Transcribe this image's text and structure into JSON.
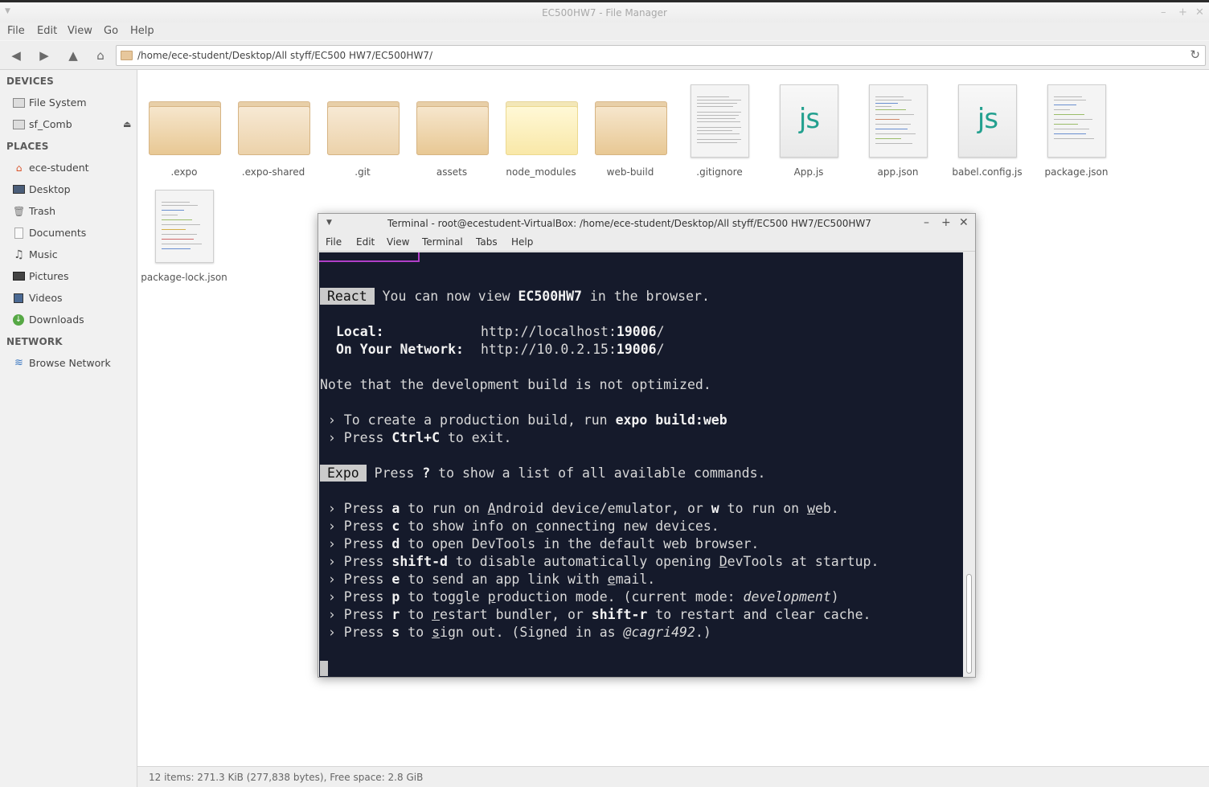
{
  "file_manager": {
    "title": "EC500HW7 - File Manager",
    "menu": [
      "File",
      "Edit",
      "View",
      "Go",
      "Help"
    ],
    "path": "/home/ece-student/Desktop/All styff/EC500 HW7/EC500HW7/",
    "sidebar": {
      "devices_heading": "DEVICES",
      "devices": [
        {
          "label": "File System",
          "icon": "drive-icon"
        },
        {
          "label": "sf_Comb",
          "icon": "drive-icon"
        }
      ],
      "places_heading": "PLACES",
      "places": [
        {
          "label": "ece-student",
          "icon": "home-icon"
        },
        {
          "label": "Desktop",
          "icon": "desktop-icon"
        },
        {
          "label": "Trash",
          "icon": "trash-icon"
        },
        {
          "label": "Documents",
          "icon": "documents-icon"
        },
        {
          "label": "Music",
          "icon": "music-icon"
        },
        {
          "label": "Pictures",
          "icon": "pictures-icon"
        },
        {
          "label": "Videos",
          "icon": "videos-icon"
        },
        {
          "label": "Downloads",
          "icon": "downloads-icon"
        }
      ],
      "network_heading": "NETWORK",
      "network": [
        {
          "label": "Browse Network",
          "icon": "network-icon"
        }
      ]
    },
    "items": [
      {
        "name": ".expo",
        "kind": "folder"
      },
      {
        "name": ".expo-shared",
        "kind": "folder"
      },
      {
        "name": ".git",
        "kind": "folder"
      },
      {
        "name": "assets",
        "kind": "folder"
      },
      {
        "name": "node_modules",
        "kind": "folder"
      },
      {
        "name": "web-build",
        "kind": "folder"
      },
      {
        "name": ".gitignore",
        "kind": "text"
      },
      {
        "name": "App.js",
        "kind": "js"
      },
      {
        "name": "app.json",
        "kind": "text"
      },
      {
        "name": "babel.config.js",
        "kind": "js"
      },
      {
        "name": "package.json",
        "kind": "text"
      },
      {
        "name": "package-lock.json",
        "kind": "text"
      }
    ],
    "js_glyph": "js",
    "status": "12 items: 271.3 KiB (277,838 bytes), Free space: 2.8 GiB"
  },
  "terminal": {
    "title": "Terminal - root@ecestudent-VirtualBox: /home/ece-student/Desktop/All styff/EC500 HW7/EC500HW7",
    "menu": [
      "File",
      "Edit",
      "View",
      "Terminal",
      "Tabs",
      "Help"
    ],
    "react_tag": "React",
    "react_line_pre": " You can now view ",
    "react_line_app": "EC500HW7",
    "react_line_post": " in the browser.",
    "local_label": "Local:",
    "local_url_pre": "http://localhost:",
    "local_port": "19006",
    "local_url_post": "/",
    "network_label": "On Your Network:",
    "network_url_pre": "http://10.0.2.15:",
    "network_port": "19006",
    "network_url_post": "/",
    "note": "Note that the development build is not optimized.",
    "build_pre": " › To create a production build, run ",
    "build_cmd": "expo build:web",
    "exit_pre": " › Press ",
    "exit_key": "Ctrl+C",
    "exit_post": " to exit.",
    "expo_tag": "Expo",
    "expo_pre": " Press ",
    "expo_key": "?",
    "expo_post": " to show a list of all available commands.",
    "press_prefix": " › Press ",
    "cmd_a_key": "a",
    "cmd_a_1": " to run on ",
    "cmd_a_u1": "A",
    "cmd_a_2": "ndroid device/emulator, or ",
    "cmd_a_key2": "w",
    "cmd_a_3": " to run on ",
    "cmd_a_u2": "w",
    "cmd_a_4": "eb.",
    "cmd_c_key": "c",
    "cmd_c_1": " to show info on ",
    "cmd_c_u": "c",
    "cmd_c_2": "onnecting new devices.",
    "cmd_d_key": "d",
    "cmd_d_1": " to open DevTools in the default web browser.",
    "cmd_sd_key": "shift-d",
    "cmd_sd_1": " to disable automatically opening ",
    "cmd_sd_u": "D",
    "cmd_sd_2": "evTools at startup.",
    "cmd_e_key": "e",
    "cmd_e_1": " to send an app link with ",
    "cmd_e_u": "e",
    "cmd_e_2": "mail.",
    "cmd_p_key": "p",
    "cmd_p_1": " to toggle ",
    "cmd_p_u": "p",
    "cmd_p_2": "roduction mode. (current mode: ",
    "cmd_p_mode": "development",
    "cmd_p_3": ")",
    "cmd_r_key": "r",
    "cmd_r_1": " to ",
    "cmd_r_u": "r",
    "cmd_r_2": "estart bundler, or ",
    "cmd_r_key2": "shift-r",
    "cmd_r_3": " to restart and clear cache.",
    "cmd_s_key": "s",
    "cmd_s_1": " to ",
    "cmd_s_u": "s",
    "cmd_s_2": "ign out. (Signed in as ",
    "cmd_s_user": "@cagri492",
    "cmd_s_3": ".)"
  }
}
